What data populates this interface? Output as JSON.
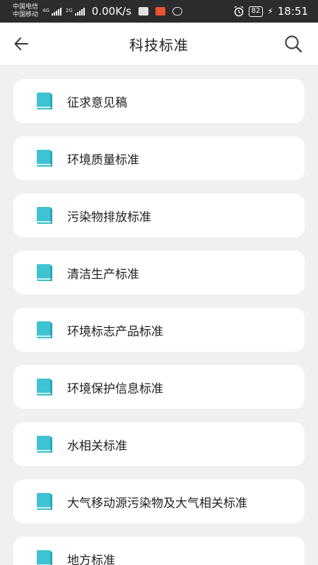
{
  "status_bar": {
    "carrier_1": "中国电信",
    "carrier_2": "中国移动",
    "network_1": "4G",
    "network_2": "2G",
    "speed": "0.00K/s",
    "battery": "82",
    "time": "18:51"
  },
  "header": {
    "title": "科技标准"
  },
  "categories": [
    {
      "label": "征求意见稿"
    },
    {
      "label": "环境质量标准"
    },
    {
      "label": "污染物排放标准"
    },
    {
      "label": "清洁生产标准"
    },
    {
      "label": "环境标志产品标准"
    },
    {
      "label": "环境保护信息标准"
    },
    {
      "label": "水相关标准"
    },
    {
      "label": "大气移动源污染物及大气相关标准"
    },
    {
      "label": "地方标准"
    }
  ],
  "colors": {
    "accent": "#3fc2d1",
    "background": "#f0f0f2",
    "status_bar": "#2c2c2c"
  }
}
